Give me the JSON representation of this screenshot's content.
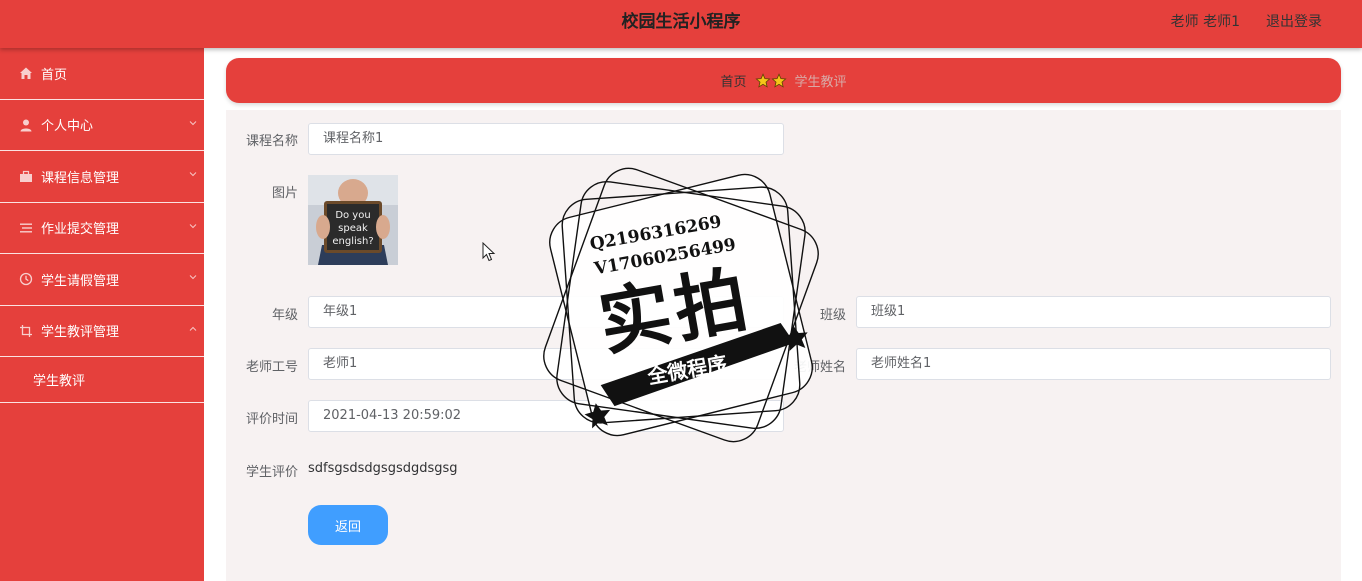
{
  "header": {
    "app_title": "校园生活小程序",
    "user_label": "老师 老师1",
    "logout_label": "退出登录"
  },
  "sidebar": {
    "items": [
      {
        "label": "首页",
        "icon": "home-icon"
      },
      {
        "label": "个人中心",
        "icon": "user-icon"
      },
      {
        "label": "课程信息管理",
        "icon": "briefcase-icon"
      },
      {
        "label": "作业提交管理",
        "icon": "list-icon"
      },
      {
        "label": "学生请假管理",
        "icon": "clock-icon"
      },
      {
        "label": "学生教评管理",
        "icon": "crop-icon"
      }
    ],
    "submenu": {
      "label": "学生教评"
    }
  },
  "breadcrumb": {
    "home": "首页",
    "current": "学生教评"
  },
  "form": {
    "course_name": {
      "label": "课程名称",
      "value": "课程名称1"
    },
    "image": {
      "label": "图片",
      "sign_text": "Do you speak english?"
    },
    "grade": {
      "label": "年级",
      "value": "年级1"
    },
    "class": {
      "label": "班级",
      "value": "班级1"
    },
    "teacher_id": {
      "label": "老师工号",
      "value": "老师1"
    },
    "teacher_name": {
      "label": "老师姓名",
      "value": "老师姓名1"
    },
    "eval_time": {
      "label": "评价时间",
      "value": "2021-04-13 20:59:02"
    },
    "student_eval": {
      "label": "学生评价",
      "value": "sdfsgsdsdgsgsdgdsgsg"
    },
    "back_label": "返回"
  },
  "watermark": {
    "line1": "Q2196316269",
    "line2": "V17060256499",
    "main": "实拍",
    "ribbon": "全微程序"
  },
  "colors": {
    "brand_red": "#e5403c",
    "button_blue": "#409eff",
    "panel_bg": "#f7f2f2"
  }
}
